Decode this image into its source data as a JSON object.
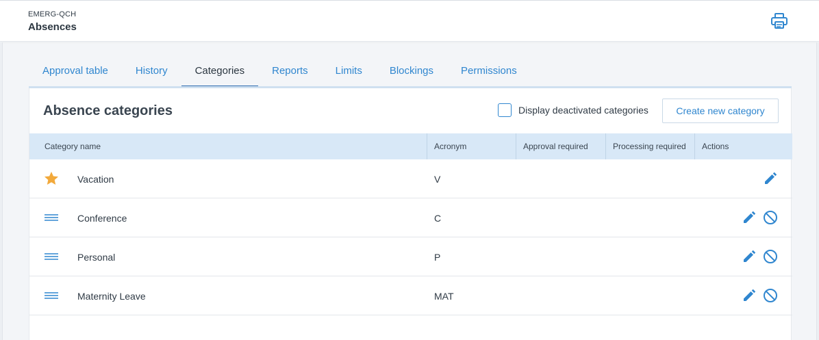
{
  "header": {
    "org": "EMERG-QCH",
    "title": "Absences",
    "print_icon": "printer-icon"
  },
  "tabs": [
    {
      "label": "Approval table",
      "active": false
    },
    {
      "label": "History",
      "active": false
    },
    {
      "label": "Categories",
      "active": true
    },
    {
      "label": "Reports",
      "active": false
    },
    {
      "label": "Limits",
      "active": false
    },
    {
      "label": "Blockings",
      "active": false
    },
    {
      "label": "Permissions",
      "active": false
    }
  ],
  "panel": {
    "title": "Absence categories",
    "deactivated_label": "Display deactivated categories",
    "deactivated_checked": false,
    "create_label": "Create new category"
  },
  "table": {
    "columns": [
      "Category name",
      "Acronym",
      "Approval required",
      "Processing required",
      "Actions"
    ],
    "rows": [
      {
        "icon": "star-icon",
        "name": "Vacation",
        "acronym": "V",
        "actions": [
          "edit-icon"
        ]
      },
      {
        "icon": "drag-handle-icon",
        "name": "Conference",
        "acronym": "C",
        "actions": [
          "edit-icon",
          "deactivate-icon"
        ]
      },
      {
        "icon": "drag-handle-icon",
        "name": "Personal",
        "acronym": "P",
        "actions": [
          "edit-icon",
          "deactivate-icon"
        ]
      },
      {
        "icon": "drag-handle-icon",
        "name": "Maternity Leave",
        "acronym": "MAT",
        "actions": [
          "edit-icon",
          "deactivate-icon"
        ]
      }
    ]
  },
  "colors": {
    "accent": "#2f86cf",
    "active_tab_underline": "#2f6db0",
    "table_header_bg": "#d8e8f7",
    "star": "#f2a93b"
  }
}
